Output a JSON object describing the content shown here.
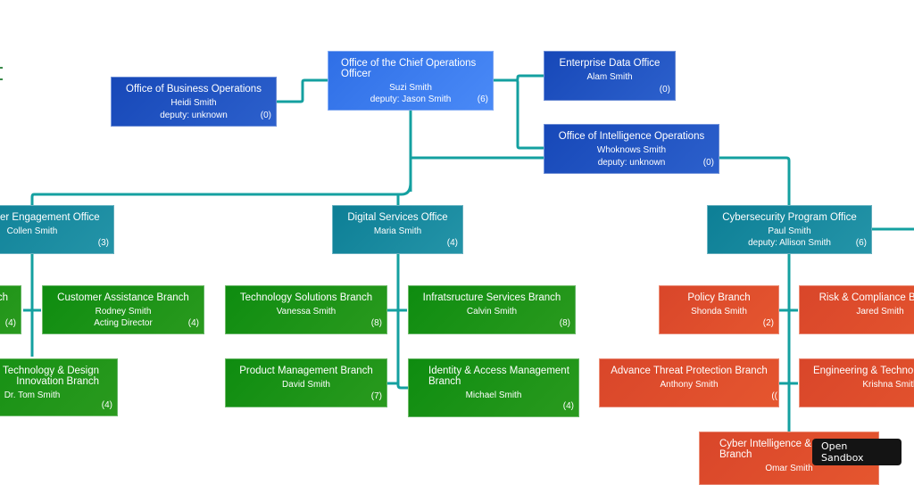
{
  "colors": {
    "root": "#3a7bef",
    "blue": "#1f53c2",
    "teal": "#15869d",
    "green": "#1a9417",
    "red": "#de4e2c",
    "connector": "#14a0a0"
  },
  "nodes": {
    "coo": {
      "title": "Office of the Chief Operations Officer",
      "person": "Suzi Smith",
      "sub": "deputy: Jason Smith",
      "count": "(6)"
    },
    "business_ops": {
      "title": "Office of Business Operations",
      "person": "Heidi Smith",
      "sub": "deputy: unknown",
      "count": "(0)"
    },
    "enterprise_data": {
      "title": "Enterprise Data Office",
      "person": "Alam Smith",
      "sub": "",
      "count": "(0)"
    },
    "intel_ops": {
      "title": "Office of Intelligence Operations",
      "person": "Whoknows Smith",
      "sub": "deputy: unknown",
      "count": "(0)"
    },
    "customer_engagement": {
      "title": "Customer Engagement Office",
      "person": "Collen Smith",
      "sub": "",
      "count": "(3)"
    },
    "digital_services": {
      "title": "Digital Services Office",
      "person": "Maria Smith",
      "sub": "",
      "count": "(4)"
    },
    "cyber_program": {
      "title": "Cybersecurity Program Office",
      "person": "Paul Smith",
      "sub": "deputy: Allison Smith",
      "count": "(6)"
    },
    "ce_left_branch": {
      "title": "...ch",
      "person": "",
      "sub": "",
      "count": "(4)"
    },
    "customer_assistance": {
      "title": "Customer Assistance Branch",
      "person": "Rodney Smith",
      "sub": "Acting Director",
      "count": "(4)"
    },
    "emerging_tech": {
      "title": "Emerging Technology & Design Innovation Branch",
      "person": "Dr. Tom Smith",
      "sub": "",
      "count": "(4)"
    },
    "tech_solutions": {
      "title": "Technology Solutions Branch",
      "person": "Vanessa Smith",
      "sub": "",
      "count": "(8)"
    },
    "infra_services": {
      "title": "Infratsructure Services Branch",
      "person": "Calvin Smith",
      "sub": "",
      "count": "(8)"
    },
    "product_mgmt": {
      "title": "Product Management Branch",
      "person": "David Smith",
      "sub": "",
      "count": "(7)"
    },
    "identity_access": {
      "title": "Identity & Access Management Branch",
      "person": "Michael Smith",
      "sub": "",
      "count": "(4)"
    },
    "policy": {
      "title": "Policy Branch",
      "person": "Shonda Smith",
      "sub": "",
      "count": "(2)"
    },
    "risk_compliance": {
      "title": "Risk & Compliance Branch",
      "person": "Jared Smith",
      "sub": "",
      "count": ""
    },
    "advance_threat": {
      "title": "Advance Threat Protection Branch",
      "person": "Anthony Smith",
      "sub": "",
      "count": "(("
    },
    "engineering_tech": {
      "title": "Engineering & Technology Branch",
      "person": "Krishna Smith",
      "sub": "",
      "count": ""
    },
    "cyber_intel": {
      "title": "Cyber Intelligence & Threat Branch",
      "person": "Omar Smith",
      "sub": "",
      "count": ""
    }
  },
  "sandbox_button": {
    "label": "Open Sandbox"
  }
}
